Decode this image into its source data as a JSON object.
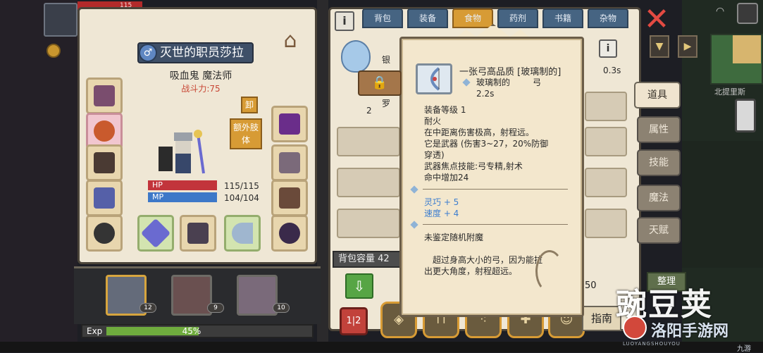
{
  "top_hud": {
    "hp_text": "115"
  },
  "character": {
    "name": "灭世的职员莎拉",
    "subtitle": "吸血鬼 魔法师",
    "power": "战斗力:75",
    "unequip_label": "卸",
    "extra_limb_label": "额外肢体",
    "hp_label": "HP",
    "hp_value": "115/115",
    "mp_label": "MP",
    "mp_value": "104/104"
  },
  "party": {
    "members": [
      {
        "level": "12"
      },
      {
        "level": "9"
      },
      {
        "level": "10"
      }
    ],
    "exp_label": "Exp",
    "exp_percent_text": "45%",
    "exp_fraction": 0.45
  },
  "inventory": {
    "tabs": [
      {
        "label": "背包"
      },
      {
        "label": "装备"
      },
      {
        "label": "食物"
      },
      {
        "label": "药剂"
      },
      {
        "label": "书籍"
      },
      {
        "label": "杂物"
      }
    ],
    "active_tab": "食物",
    "row_text": "银",
    "row2_count": "2",
    "row2_text": "罗",
    "capacity_label": "背包容量 42",
    "right_value": "0.3s",
    "count_50": "50",
    "sort_label": "整理",
    "guide_label": "指南"
  },
  "side_tabs": [
    {
      "label": "道具"
    },
    {
      "label": "属性"
    },
    {
      "label": "技能"
    },
    {
      "label": "魔法"
    },
    {
      "label": "天赋"
    }
  ],
  "map": {
    "label": "北提里斯"
  },
  "tooltip": {
    "title": "一张弓高品质 [玻璃制的]",
    "material": "玻璃制的",
    "type": "弓",
    "weight": "2.2s",
    "lines": [
      "装备等级 1",
      "耐火",
      "在中距离伤害极高，射程远。",
      "它是武器 (伤害3~27，20%防御",
      "穿透)",
      "武器焦点技能:弓专精,射术",
      "命中增加24"
    ],
    "bonuses": [
      "灵巧 + 5",
      "速度 + 4"
    ],
    "enchant": "未鉴定随机附魔",
    "flavor_lines": [
      "超过身高大小的弓，因为能拉",
      "出更大角度，射程超远。"
    ]
  },
  "watermark": {
    "main": "豌豆荚",
    "sub": "洛阳手游网",
    "url": "LUOYANGSHOUYOU",
    "corner": "九游"
  },
  "colors": {
    "panel": "#efe7d5",
    "tab_blue": "#466482",
    "tab_active": "#d79b35",
    "hp_red": "#c2343b",
    "mp_blue": "#3d78c8",
    "exp_green": "#6fac3e",
    "power_red": "#c84634",
    "bonus_blue": "#3d7ecf",
    "close_red": "#e34a42"
  }
}
